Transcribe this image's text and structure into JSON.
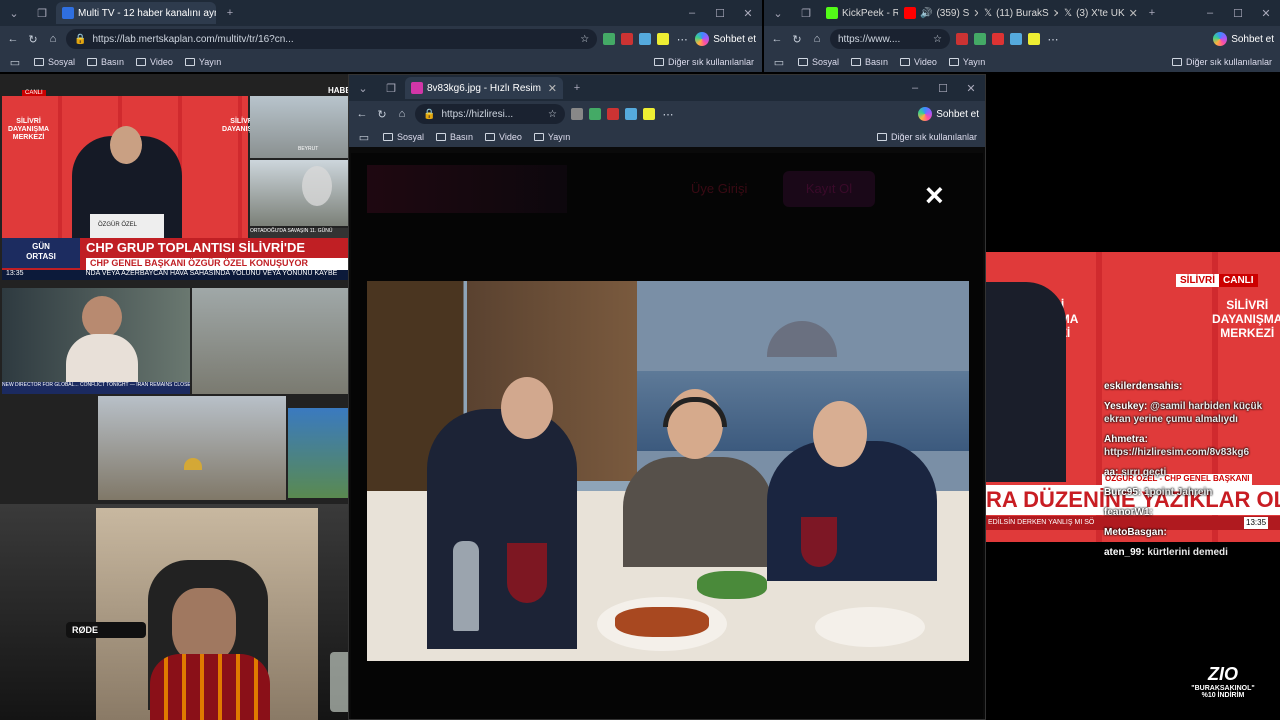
{
  "left_browser": {
    "tabs": [
      {
        "label": "Multi TV - 12 haber kanalını aynı a"
      }
    ],
    "url": "https://lab.mertskaplan.com/multitv/tr/16?cn...",
    "bookmarks": [
      "Sosyal",
      "Basın",
      "Video",
      "Yayın"
    ],
    "other_bookmarks": "Diğer sık kullanılanlar",
    "chat_button": "Sohbet et"
  },
  "right_browser": {
    "tabs": [
      {
        "label": "KickPeek - R"
      },
      {
        "label": "(359) S"
      },
      {
        "label": "(11) BurakS"
      },
      {
        "label": "(3) X'te UK"
      }
    ],
    "url": "https://www....",
    "bookmarks": [
      "Sosyal",
      "Basın",
      "Video",
      "Yayın"
    ],
    "other_bookmarks": "Diğer sık kullanılanlar",
    "chat_button": "Sohbet et"
  },
  "popup_browser": {
    "tab_label": "8v83kg6.jpg - Hızlı Resim",
    "url": "https://hizliresi...",
    "bookmarks": [
      "Sosyal",
      "Basın",
      "Video",
      "Yayın"
    ],
    "other_bookmarks": "Diğer sık kullanılanlar",
    "chat_button": "Sohbet et",
    "site_nav": {
      "register_link": "Üye Girişi",
      "signup_button": "Kayıt Ol"
    },
    "close_symbol": "×"
  },
  "tv_grid": {
    "live_badge": "CANLI",
    "channel_logo": "HABER",
    "backdrop_text": [
      "SİLİVRİ",
      "DAYANIŞMA",
      "MERKEZİ"
    ],
    "speaker_caption": "ÖZGÜR ÖZEL",
    "side_caption_1": "BEYRUT",
    "side_caption_2": "ORTADOĞU'DA SAVAŞIN 11. GÜNÜ",
    "program_label": [
      "GÜN",
      "ORTASI"
    ],
    "headline": "CHP GRUP TOPLANTISI SİLİVRİ'DE",
    "subheadline": "CHP GENEL BAŞKANI ÖZGÜR ÖZEL KONUŞUYOR",
    "ticker": "NDA VEYA AZERBAYCAN HAVA SAHASINDA YOLUNU VEYA YÖNÜNÜ KAYBE",
    "clock": "13:35",
    "interview_ticker": "NEW DIRECTOR FOR GLOBAL... CONFLICT TONIGHT — IRAN REMAINS CLOSED"
  },
  "right_stream": {
    "live_channel": "SİLİVRİ",
    "live_badge": "CANLI",
    "backdrop_text": [
      "SİLİVRİ",
      "DAYANIŞMA",
      "MERKEZİ"
    ],
    "lower_caption": "ÖZGÜR ÖZEL - CHP GENEL BAŞKANI",
    "headline": "RA DÜZENİNE YAZIKLAR OLSUN",
    "ticker": "EDİLSİN DERKEN YANLIŞ MI SÖ",
    "clock": "13:35"
  },
  "chat": [
    {
      "user": "eskilerdensahis:",
      "text": ""
    },
    {
      "user": "Yesukey:",
      "text": "@samil harbiden küçük ekran yerine çumu almalıydı"
    },
    {
      "user": "Ahmetra:",
      "text": "https://hizliresim.com/8v83kg6"
    },
    {
      "user": "aa:",
      "text": "sırrı geçti"
    },
    {
      "user": "Burc95:",
      "text": "1point Jahrein"
    },
    {
      "user": "feanorW1:",
      "text": ""
    },
    {
      "user": "MetoBasgan:",
      "text": ""
    },
    {
      "user": "aten_99:",
      "text": "kürtlerini demedi"
    }
  ],
  "sponsor": {
    "logo": "ZIO",
    "code": "\"BURAKSAKINOL\"",
    "discount": "%10 İNDİRİM"
  },
  "webcam": {
    "mic_brand": "RØDE"
  },
  "colors": {
    "browser_tab": "#1f2a38",
    "browser_bar": "#2b3646",
    "news_red": "#d8242a",
    "accent_blue": "#2f6fe0"
  }
}
